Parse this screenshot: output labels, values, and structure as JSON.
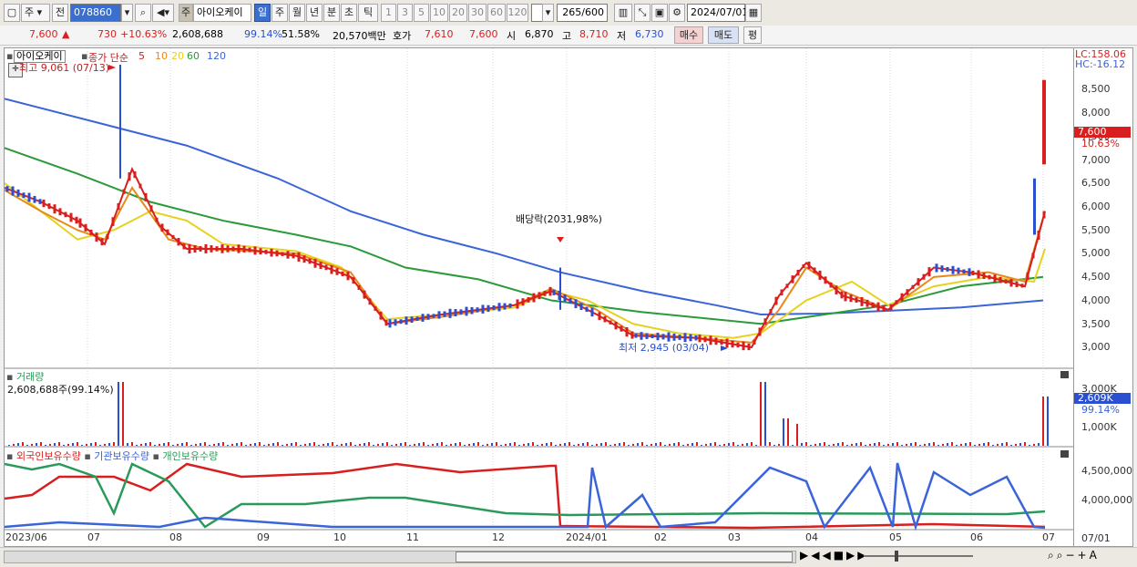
{
  "toolbar": {
    "market": "주",
    "prev_label": "전",
    "code": "078860",
    "stock_name": "아이오케이",
    "name_prefix": "주",
    "periods": [
      "일",
      "주",
      "월",
      "년",
      "분",
      "초",
      "틱"
    ],
    "period_selected": "일",
    "minutes": [
      "1",
      "3",
      "5",
      "10",
      "20",
      "30",
      "60",
      "120"
    ],
    "count_value": "265",
    "count_total": "/600",
    "date": "2024/07/01"
  },
  "quote": {
    "price": "7,600",
    "change": "730",
    "change_pct": "+10.63%",
    "volume": "2,608,688",
    "volume_ratio": "99.14%",
    "turnover": "51.58%",
    "amount": "20,570백만",
    "ask_label": "호가",
    "ask": "7,610",
    "bid": "7,600",
    "open_label": "시",
    "open": "6,870",
    "high_label": "고",
    "high": "8,710",
    "low_label": "저",
    "low": "6,730",
    "buy_label": "매수",
    "sell_label": "매도",
    "avg_label": "평"
  },
  "price_panel": {
    "title": "아이오케이",
    "ma_label": "종가 단순",
    "ma_periods": [
      {
        "v": "5",
        "c": "#d81e1e"
      },
      {
        "v": "10",
        "c": "#e88a1a"
      },
      {
        "v": "20",
        "c": "#e6d21e"
      },
      {
        "v": "60",
        "c": "#2a9a3a"
      },
      {
        "v": "120",
        "c": "#3a64d8"
      }
    ],
    "high_note": "최고 9,061 (07/13)",
    "low_note": "최저 2,945 (03/04)",
    "dividend_note": "배당락(2031,98%)",
    "lc": "LC:158.06",
    "hc": "HC:-16.12",
    "last_price": "7,600",
    "last_pct": "10.63%",
    "y_ticks": [
      "8,500",
      "8,000",
      "7,500",
      "7,000",
      "6,500",
      "6,000",
      "5,500",
      "5,000",
      "4,500",
      "4,000",
      "3,500",
      "3,000"
    ]
  },
  "volume_panel": {
    "title": "거래량",
    "value": "2,608,688주(99.14%)",
    "last_value": "2,609K",
    "last_pct": "99.14%",
    "y_ticks": [
      "3,000K",
      "1,000K"
    ]
  },
  "holdings_panel": {
    "series": [
      {
        "name": "외국인보유수량",
        "color": "#d81e1e"
      },
      {
        "name": "기관보유수량",
        "color": "#3a64d8"
      },
      {
        "name": "개인보유수량",
        "color": "#2a9a5a"
      }
    ],
    "y_ticks": [
      "4,500,000",
      "4,000,000"
    ]
  },
  "x_axis": [
    "2023/06",
    "07",
    "08",
    "09",
    "10",
    "11",
    "12",
    "2024/01",
    "02",
    "03",
    "04",
    "05",
    "06",
    "07"
  ],
  "x_axis_right": "07/01",
  "colors": {
    "up": "#d81e1e",
    "down": "#2a4fd0",
    "ma5": "#d81e1e",
    "ma10": "#e88a1a",
    "ma20": "#e6d21e",
    "ma60": "#2a9a3a",
    "ma120": "#3a64d8"
  }
}
